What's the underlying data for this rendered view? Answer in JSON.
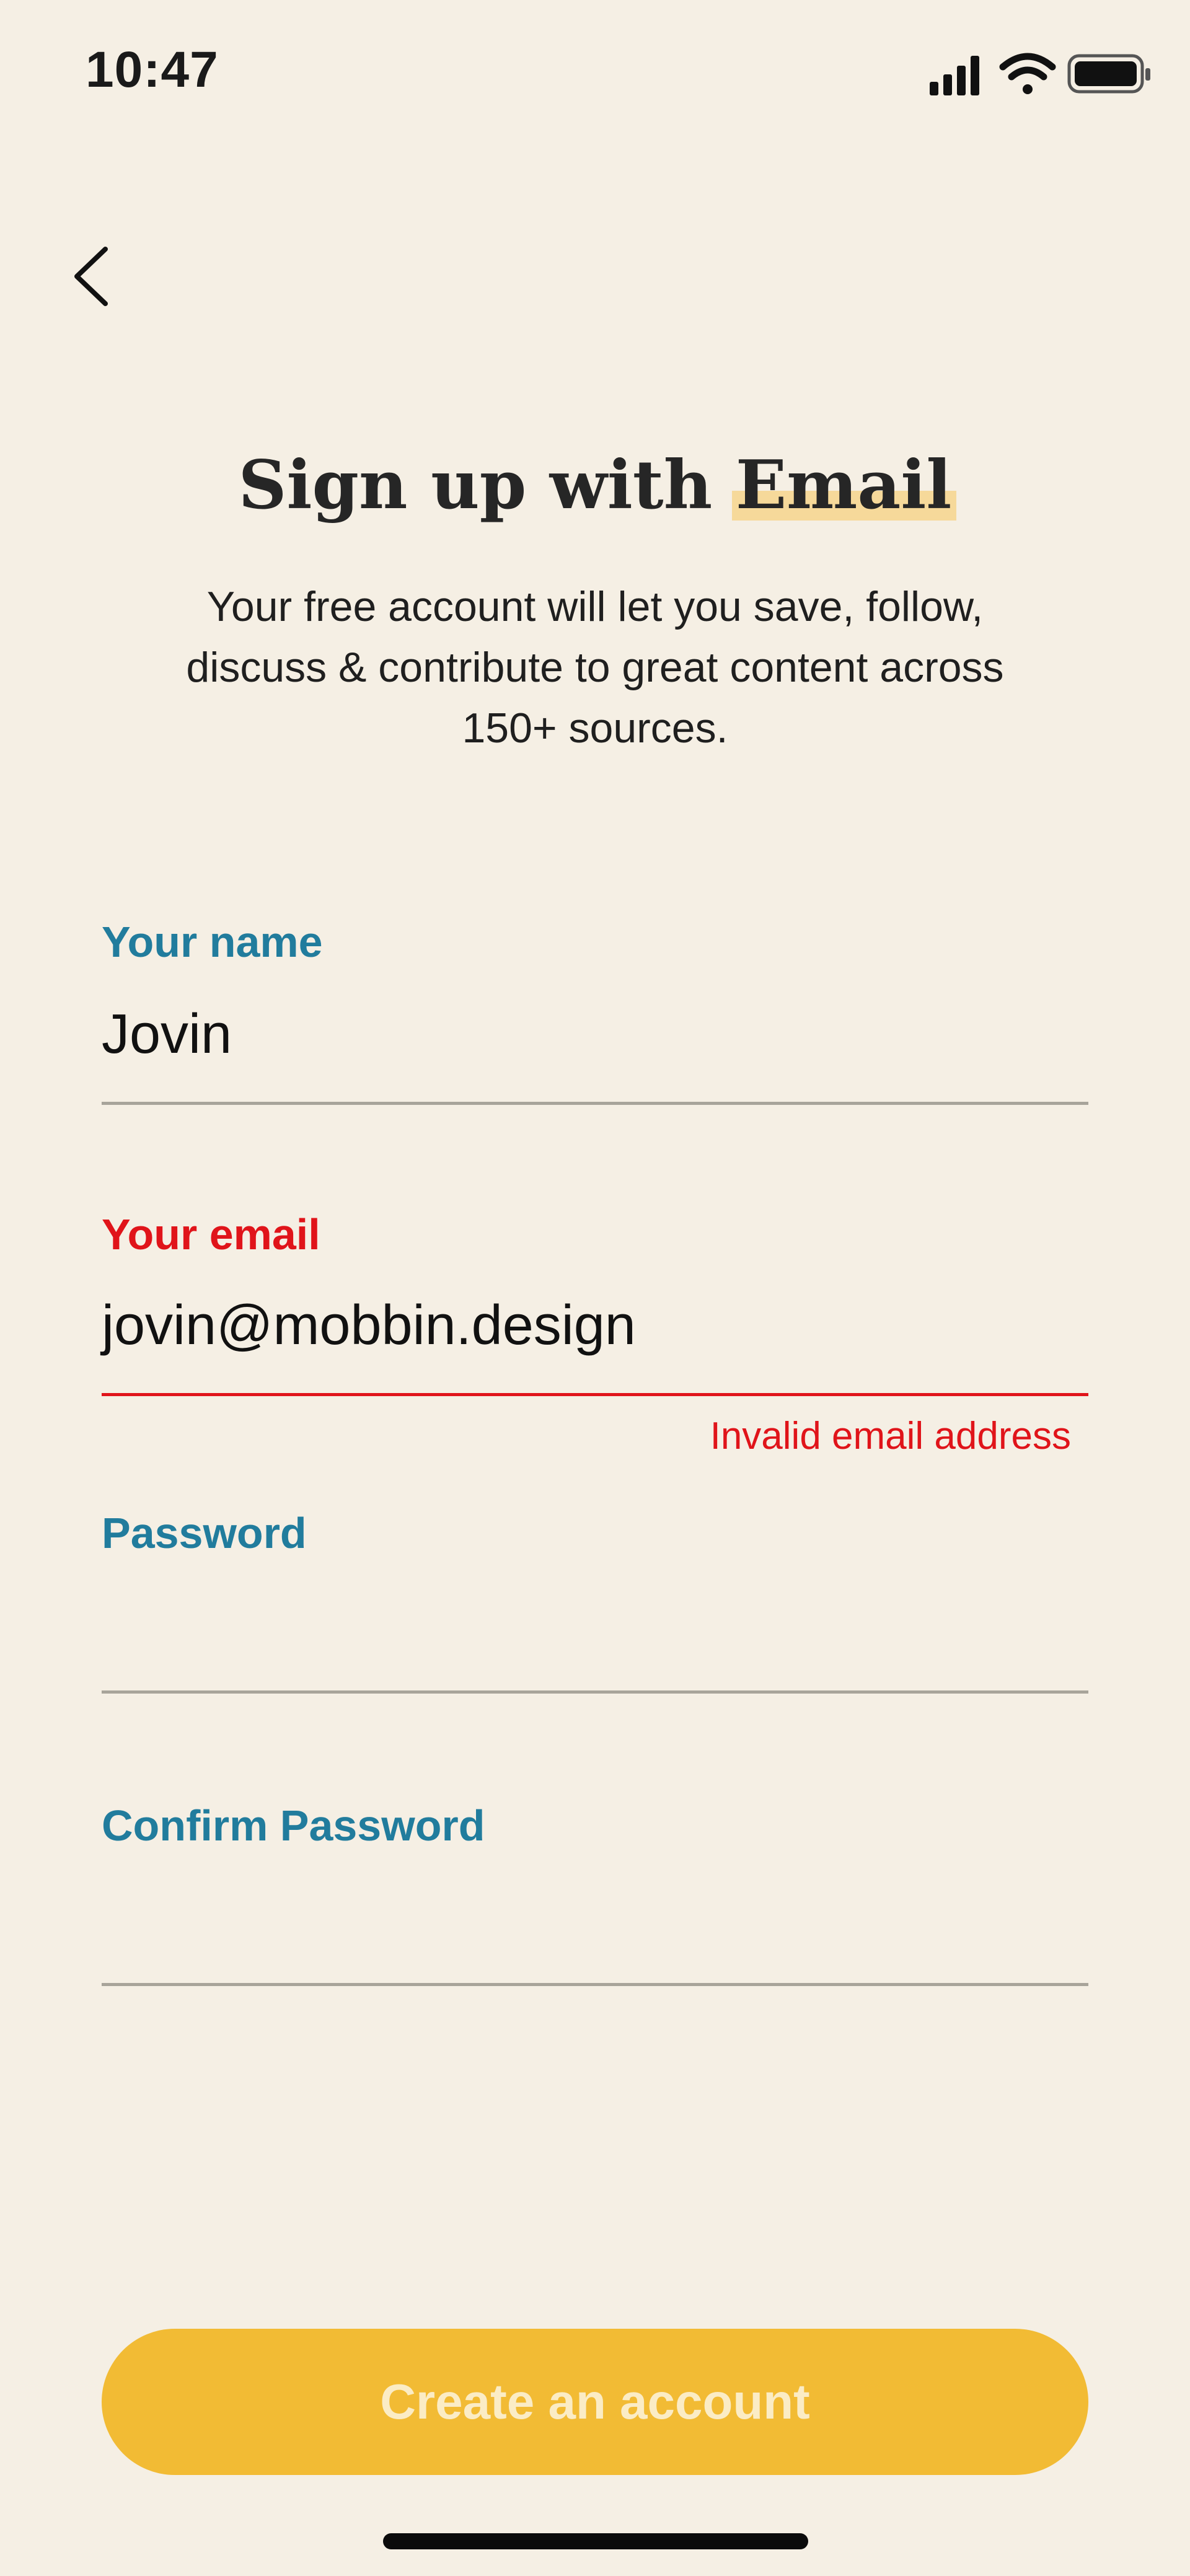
{
  "status_bar": {
    "time": "10:47"
  },
  "header": {
    "title_prefix": "Sign up with",
    "title_highlight": "Email",
    "subtitle": "Your free account will let you save, follow, discuss & contribute to great content across 150+ sources."
  },
  "form": {
    "name": {
      "label": "Your name",
      "value": "Jovin"
    },
    "email": {
      "label": "Your email",
      "value": "jovin@mobbin.design",
      "error": "Invalid email address"
    },
    "password": {
      "label": "Password",
      "value": ""
    },
    "confirm_password": {
      "label": "Confirm Password",
      "value": ""
    }
  },
  "actions": {
    "create_account_label": "Create an account"
  },
  "colors": {
    "background": "#f5efe4",
    "label_accent": "#217c9d",
    "error": "#e0141a",
    "button": "#f2bb34",
    "highlight": "#f6d99a"
  }
}
